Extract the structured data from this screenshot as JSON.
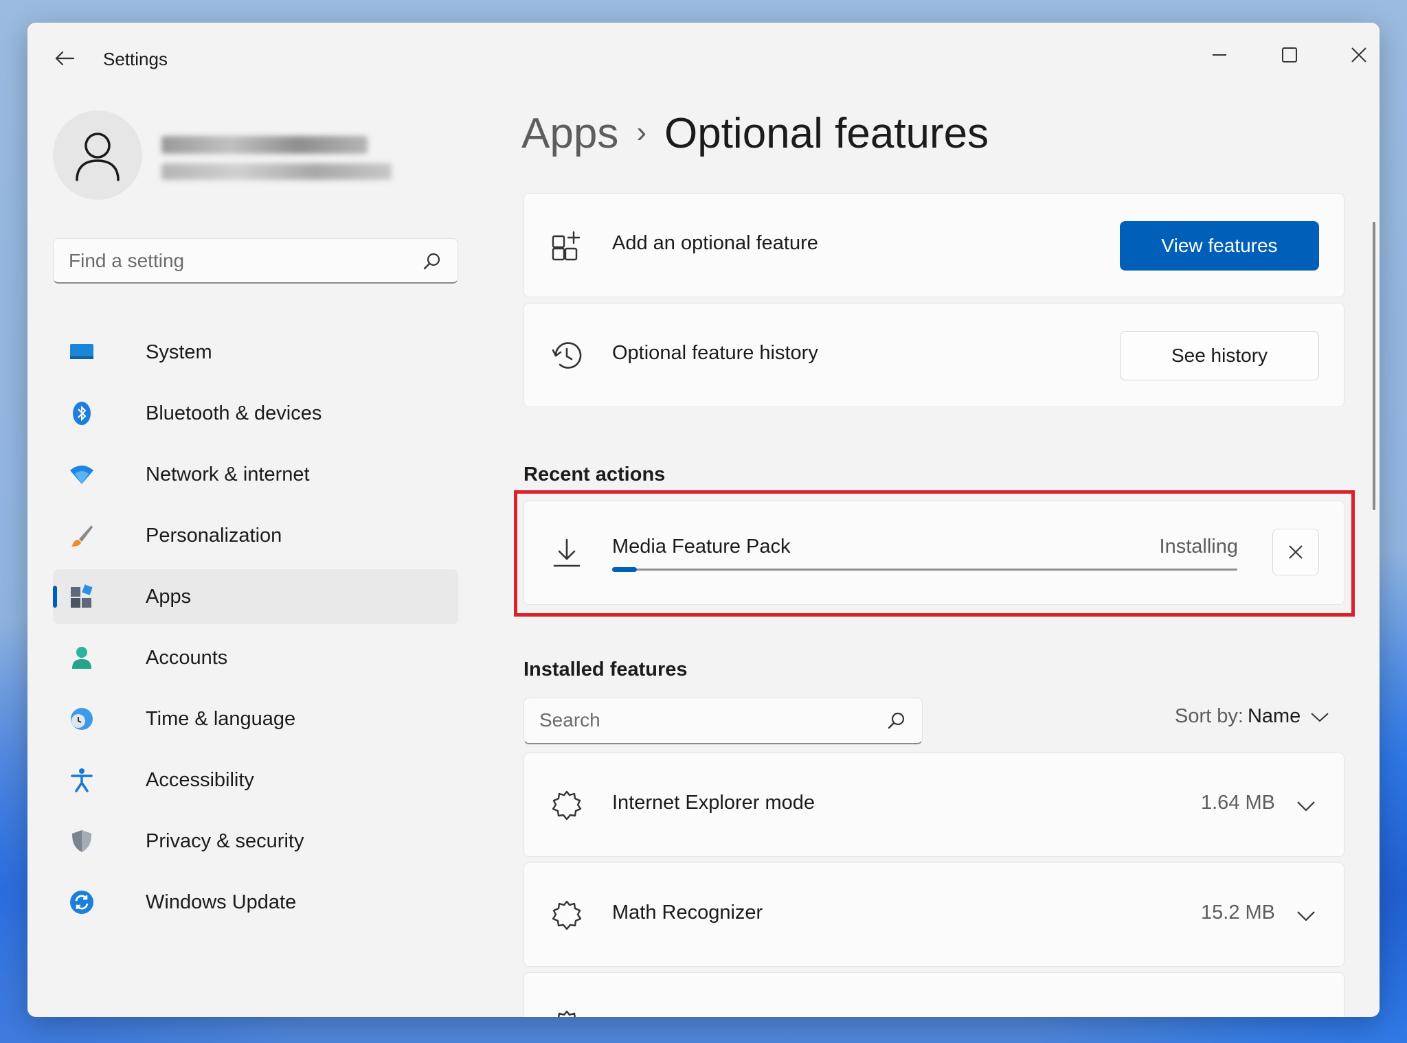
{
  "window": {
    "title": "Settings"
  },
  "search": {
    "placeholder": "Find a setting"
  },
  "sidebar": {
    "items": [
      {
        "label": "System",
        "icon": "monitor-icon"
      },
      {
        "label": "Bluetooth & devices",
        "icon": "bluetooth-icon"
      },
      {
        "label": "Network & internet",
        "icon": "wifi-icon"
      },
      {
        "label": "Personalization",
        "icon": "brush-icon"
      },
      {
        "label": "Apps",
        "icon": "apps-icon",
        "active": true
      },
      {
        "label": "Accounts",
        "icon": "person-icon"
      },
      {
        "label": "Time & language",
        "icon": "globe-clock-icon"
      },
      {
        "label": "Accessibility",
        "icon": "accessibility-icon"
      },
      {
        "label": "Privacy & security",
        "icon": "shield-icon"
      },
      {
        "label": "Windows Update",
        "icon": "update-icon"
      }
    ]
  },
  "breadcrumb": {
    "parent": "Apps",
    "current": "Optional features"
  },
  "add_card": {
    "label": "Add an optional feature",
    "button": "View features"
  },
  "history_card": {
    "label": "Optional feature history",
    "button": "See history"
  },
  "recent": {
    "title": "Recent actions",
    "item": {
      "name": "Media Feature Pack",
      "status": "Installing",
      "progress_fraction": 0.04
    }
  },
  "installed": {
    "title": "Installed features",
    "search_placeholder": "Search",
    "sort_label": "Sort by:",
    "sort_value": "Name",
    "items": [
      {
        "name": "Internet Explorer mode",
        "size": "1.64 MB"
      },
      {
        "name": "Math Recognizer",
        "size": "15.2 MB"
      }
    ]
  },
  "colors": {
    "accent": "#005fb8",
    "highlight": "#d8232a"
  }
}
